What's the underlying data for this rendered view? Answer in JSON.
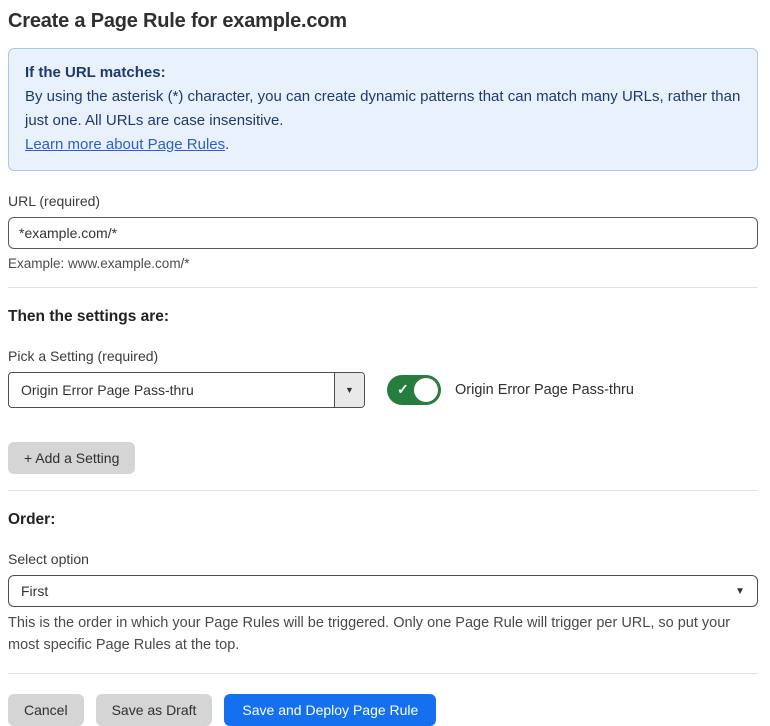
{
  "page": {
    "title": "Create a Page Rule for example.com"
  },
  "info_box": {
    "heading": "If the URL matches:",
    "body": "By using the asterisk (*) character, you can create dynamic patterns that can match many URLs, rather than just one. All URLs are case insensitive.",
    "link_label": "Learn more about Page Rules",
    "link_suffix": "."
  },
  "url_field": {
    "label": "URL (required)",
    "value": "*example.com/*",
    "helper": "Example: www.example.com/*"
  },
  "settings_section": {
    "heading": "Then the settings are:",
    "picker_label": "Pick a Setting (required)",
    "picker_value": "Origin Error Page Pass-thru",
    "toggle_state": "on",
    "toggle_label": "Origin Error Page Pass-thru",
    "add_setting_label": "+ Add a Setting"
  },
  "order_section": {
    "heading": "Order:",
    "select_label": "Select option",
    "select_value": "First",
    "helper": "This is the order in which your Page Rules will be triggered. Only one Page Rule will trigger per URL, so put your most specific Page Rules at the top."
  },
  "actions": {
    "cancel_label": "Cancel",
    "save_draft_label": "Save as Draft",
    "save_deploy_label": "Save and Deploy Page Rule"
  },
  "icons": {
    "check": "✓",
    "caret_down": "▼"
  },
  "colors": {
    "accent_blue": "#1570f0",
    "toggle_green": "#267d3e",
    "info_background": "#e9f2fc",
    "info_border": "#a9c9ea",
    "info_text": "#1d3a6e",
    "link_blue": "#2b5fc7"
  }
}
